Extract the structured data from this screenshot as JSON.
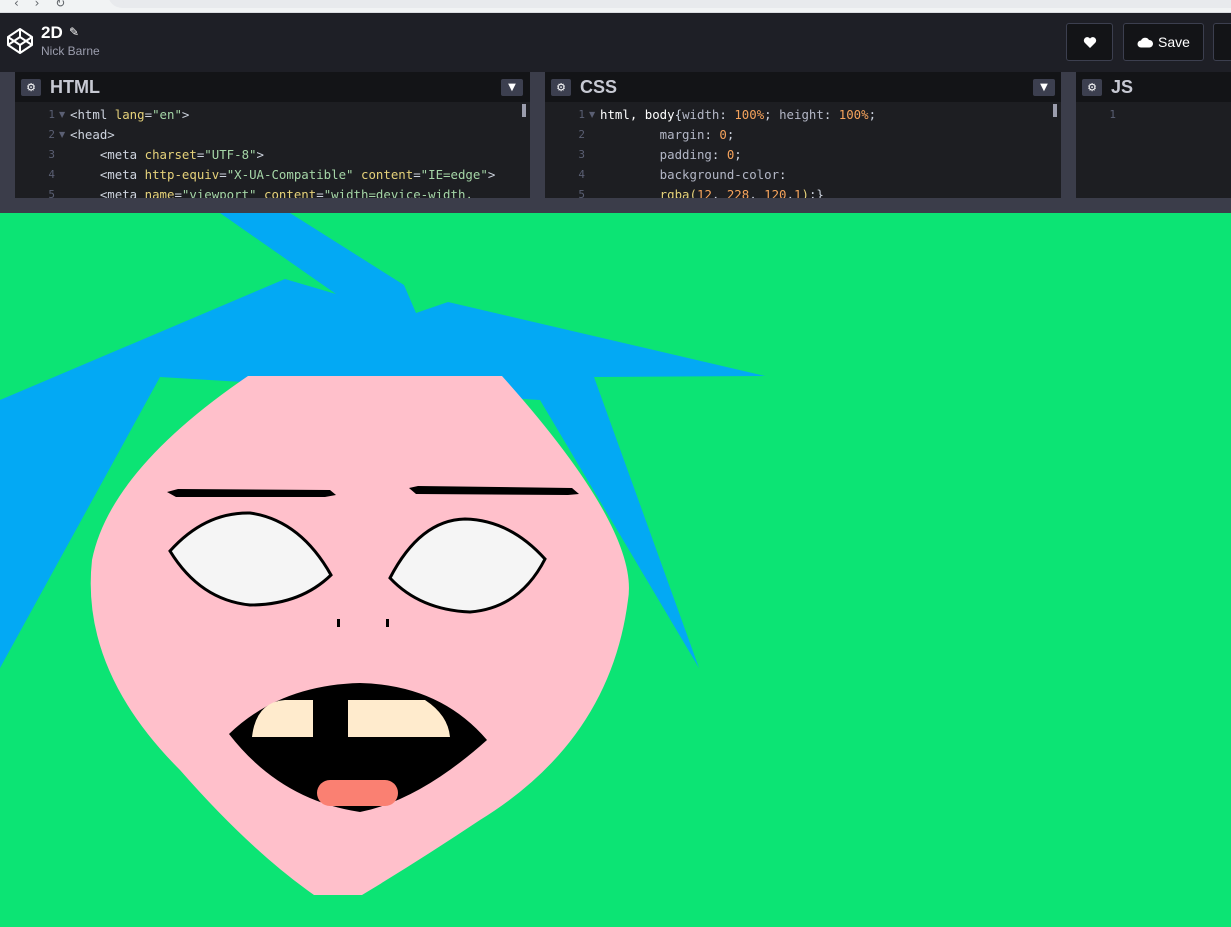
{
  "header": {
    "pen_title": "2D",
    "author": "Nick Barne",
    "save_label": "Save",
    "icons": [
      "codepen-logo-icon",
      "pencil-icon",
      "heart-icon",
      "cloud-icon"
    ]
  },
  "editors": [
    {
      "title": "HTML",
      "lines": [
        {
          "n": "1",
          "fold": true,
          "parts": [
            [
              "tag",
              "<html "
            ],
            [
              "attr",
              "lang"
            ],
            [
              "tag",
              "="
            ],
            [
              "str",
              "\"en\""
            ],
            [
              "tag",
              ">"
            ]
          ]
        },
        {
          "n": "2",
          "fold": true,
          "parts": [
            [
              "tag",
              "<head>"
            ]
          ]
        },
        {
          "n": "3",
          "fold": false,
          "parts": [
            [
              "tag",
              "    <meta "
            ],
            [
              "attr",
              "charset"
            ],
            [
              "tag",
              "="
            ],
            [
              "str",
              "\"UTF-8\""
            ],
            [
              "tag",
              ">"
            ]
          ]
        },
        {
          "n": "4",
          "fold": false,
          "parts": [
            [
              "tag",
              "    <meta "
            ],
            [
              "attr",
              "http-equiv"
            ],
            [
              "tag",
              "="
            ],
            [
              "str",
              "\"X-UA-Compatible\""
            ],
            [
              "tag",
              " "
            ],
            [
              "attr",
              "content"
            ],
            [
              "tag",
              "="
            ],
            [
              "str",
              "\"IE=edge\""
            ],
            [
              "tag",
              ">"
            ]
          ]
        },
        {
          "n": "5",
          "fold": false,
          "parts": [
            [
              "tag",
              "    <meta "
            ],
            [
              "attr",
              "name"
            ],
            [
              "tag",
              "="
            ],
            [
              "str",
              "\"viewport\""
            ],
            [
              "tag",
              " "
            ],
            [
              "attr",
              "content"
            ],
            [
              "tag",
              "="
            ],
            [
              "str",
              "\"width=device-width,"
            ]
          ]
        }
      ]
    },
    {
      "title": "CSS",
      "lines": [
        {
          "n": "1",
          "fold": true,
          "parts": [
            [
              "sel",
              "html, body"
            ],
            [
              "tag",
              "{"
            ],
            [
              "prop",
              "width"
            ],
            [
              "tag",
              ": "
            ],
            [
              "num",
              "100%"
            ],
            [
              "tag",
              "; "
            ],
            [
              "prop",
              "height"
            ],
            [
              "tag",
              ": "
            ],
            [
              "num",
              "100%"
            ],
            [
              "tag",
              ";"
            ]
          ]
        },
        {
          "n": "2",
          "fold": false,
          "parts": [
            [
              "prop",
              "        margin"
            ],
            [
              "tag",
              ": "
            ],
            [
              "num",
              "0"
            ],
            [
              "tag",
              ";"
            ]
          ]
        },
        {
          "n": "3",
          "fold": false,
          "parts": [
            [
              "prop",
              "        padding"
            ],
            [
              "tag",
              ": "
            ],
            [
              "num",
              "0"
            ],
            [
              "tag",
              ";"
            ]
          ]
        },
        {
          "n": "4",
          "fold": false,
          "parts": [
            [
              "prop",
              "        background-color"
            ],
            [
              "tag",
              ":"
            ]
          ]
        },
        {
          "n": "5",
          "fold": false,
          "parts": [
            [
              "attr",
              "        rgba("
            ],
            [
              "num",
              "12"
            ],
            [
              "tag",
              ", "
            ],
            [
              "num",
              "228"
            ],
            [
              "tag",
              ", "
            ],
            [
              "num",
              "120"
            ],
            [
              "tag",
              ","
            ],
            [
              "num",
              "1"
            ],
            [
              "attr",
              ")"
            ],
            [
              "tag",
              ";}"
            ]
          ]
        }
      ]
    },
    {
      "title": "JS",
      "lines": [
        {
          "n": "1",
          "fold": false,
          "parts": []
        }
      ]
    }
  ],
  "preview": {
    "background": "#0ce474",
    "hair_color": "#03a9f4",
    "skin_color": "#ffc0cb",
    "eye_color": "#f5f5f5",
    "teeth_color": "#ffebcd",
    "tongue_color": "#fa8072",
    "mouth_color": "#000000"
  }
}
